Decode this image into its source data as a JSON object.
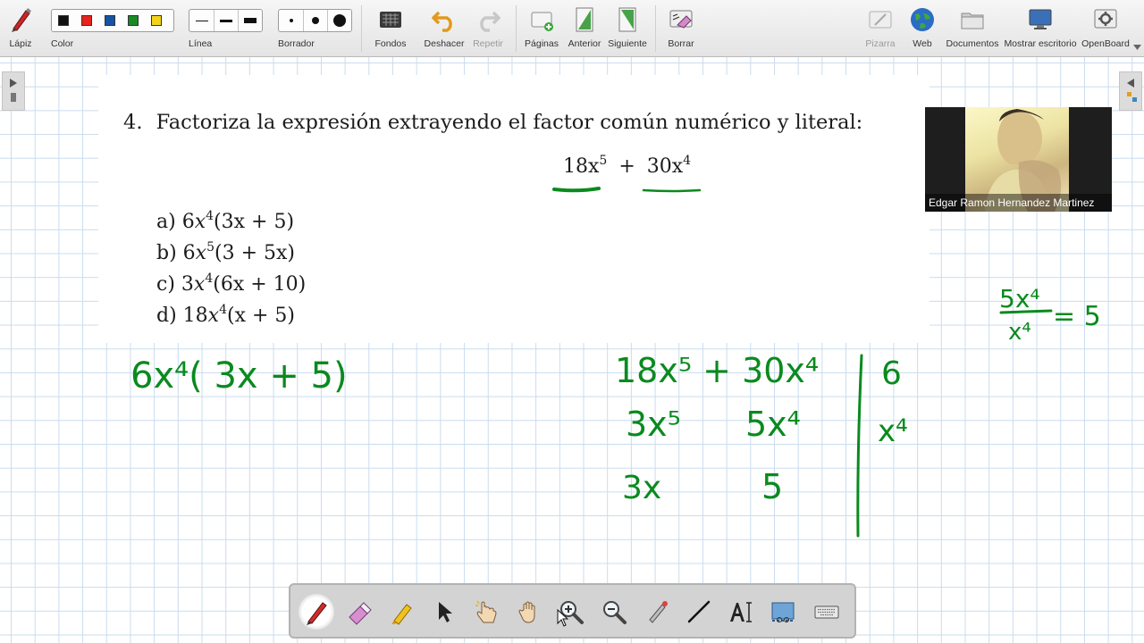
{
  "toolbar": {
    "lapiz": "Lápiz",
    "color": "Color",
    "linea": "Línea",
    "borrador": "Borrador",
    "fondos": "Fondos",
    "deshacer": "Deshacer",
    "repetir": "Repetir",
    "paginas": "Páginas",
    "anterior": "Anterior",
    "siguiente": "Siguiente",
    "borrar": "Borrar",
    "pizarra": "Pizarra",
    "web": "Web",
    "documentos": "Documentos",
    "mostrar_escritorio": "Mostrar escritorio",
    "openboard": "OpenBoard",
    "colors": [
      "#111111",
      "#e8231c",
      "#1553a4",
      "#1a8a24",
      "#f3d31a"
    ]
  },
  "question": {
    "number": "4.",
    "prompt": "Factoriza la expresión extrayendo el factor común numérico y literal:",
    "expr_a": "18x",
    "expr_a_exp": "5",
    "expr_plus": "+",
    "expr_b": "30x",
    "expr_b_exp": "4"
  },
  "options": [
    {
      "label": "a)",
      "coef": "6",
      "var": "x",
      "exp": "4",
      "rest": "(3x + 5)"
    },
    {
      "label": "b)",
      "coef": "6",
      "var": "x",
      "exp": "5",
      "rest": "(3 + 5x)"
    },
    {
      "label": "c)",
      "coef": "3",
      "var": "x",
      "exp": "4",
      "rest": "(6x + 10)"
    },
    {
      "label": "d)",
      "coef": "18",
      "var": "x",
      "exp": "4",
      "rest": "(x + 5)"
    }
  ],
  "handwriting": {
    "answer": "6x⁴( 3x + 5)",
    "row1": "18x⁵ + 30x⁴",
    "row2_left": "3x⁵",
    "row2_right": "5x⁴",
    "row3_left": "3x",
    "row3_right": "5",
    "factor1": "6",
    "factor2": "x⁴",
    "side_num": "5x⁴",
    "side_den": "x⁴",
    "side_result": "= 5"
  },
  "webcam": {
    "name": "Edgar Ramon Hernandez Martinez"
  },
  "ink_color": "#0a8a1e"
}
